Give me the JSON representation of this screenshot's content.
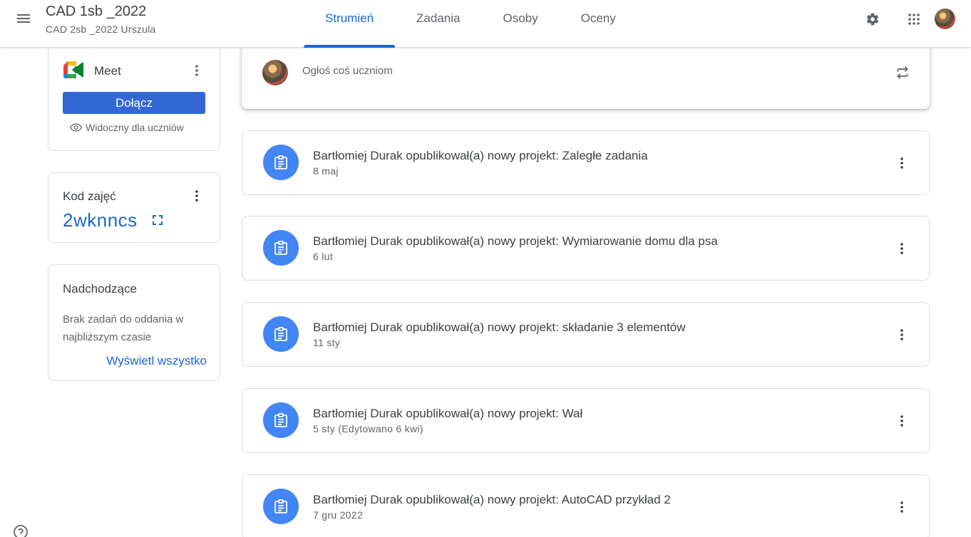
{
  "header": {
    "menu_icon": "hamburger-menu-icon",
    "class_title": "CAD 1sb _2022",
    "class_subtitle": "CAD 2sb _2022 Urszula",
    "tabs": [
      {
        "label": "Strumień",
        "active": true
      },
      {
        "label": "Zadania",
        "active": false
      },
      {
        "label": "Osoby",
        "active": false
      },
      {
        "label": "Oceny",
        "active": false
      }
    ],
    "settings_icon": "gear-icon",
    "apps_icon": "apps-grid-icon",
    "accent_color": "#1967d2"
  },
  "meet": {
    "title": "Meet",
    "join_label": "Dołącz",
    "visibility_note": "Widoczny dla uczniów"
  },
  "class_code": {
    "label": "Kod zajęć",
    "value": "2wknncs"
  },
  "upcoming": {
    "title": "Nadchodzące",
    "empty_text": "Brak zadań do oddania w najbliższym czasie",
    "view_all_label": "Wyświetl wszystko"
  },
  "announce": {
    "placeholder": "Ogłoś coś uczniom"
  },
  "posts": [
    {
      "title": "Bartłomiej Durak opublikował(a) nowy projekt: Zaległe zadania",
      "date": "8 maj"
    },
    {
      "title": "Bartłomiej Durak opublikował(a) nowy projekt: Wymiarowanie domu dla psa",
      "date": "6 lut"
    },
    {
      "title": "Bartłomiej Durak opublikował(a) nowy projekt: składanie 3 elementów",
      "date": "11 sty"
    },
    {
      "title": "Bartłomiej Durak opublikował(a) nowy projekt: Wał",
      "date": "5 sty (Edytowano 6 kwi)"
    },
    {
      "title": "Bartłomiej Durak opublikował(a) nowy projekt: AutoCAD przykład 2",
      "date": "7 gru 2022"
    }
  ]
}
